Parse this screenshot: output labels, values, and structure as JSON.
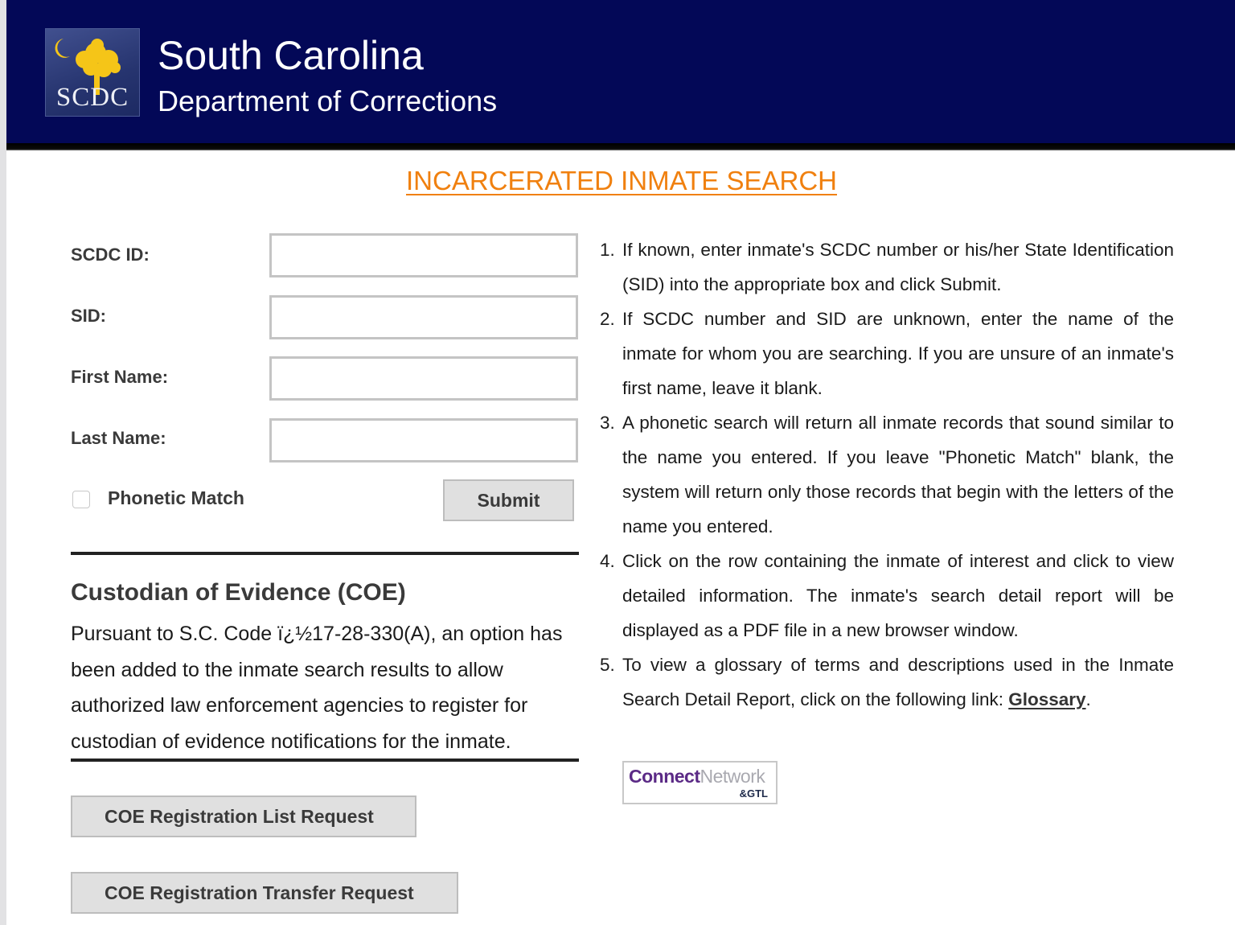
{
  "header": {
    "logo_text": "SCDC",
    "title": "South Carolina",
    "subtitle": "Department of Corrections"
  },
  "page": {
    "title": "INCARCERATED INMATE SEARCH",
    "accent_color": "#f0800f",
    "header_color": "#030857"
  },
  "form": {
    "fields": [
      {
        "label": "SCDC ID:",
        "value": "",
        "placeholder": ""
      },
      {
        "label": "SID:",
        "value": "",
        "placeholder": ""
      },
      {
        "label": "First Name:",
        "value": "",
        "placeholder": ""
      },
      {
        "label": "Last Name:",
        "value": "",
        "placeholder": ""
      }
    ],
    "phonetic_label": "Phonetic Match",
    "phonetic_checked": false,
    "submit_label": "Submit"
  },
  "coe": {
    "title": "Custodian of Evidence (COE)",
    "text": "Pursuant to S.C. Code ï¿½17-28-330(A), an option has been added to the inmate search results to allow authorized law enforcement agencies to register for custodian of evidence notifications for the inmate.",
    "list_request_label": "COE Registration List Request",
    "transfer_request_label": "COE Registration Transfer Request"
  },
  "instructions": {
    "items": [
      {
        "num": "1.",
        "text": "If known, enter inmate's SCDC number or his/her State Identification (SID) into the appropriate box and click Submit."
      },
      {
        "num": "2.",
        "text": "If SCDC number and SID are unknown, enter the name of the inmate for whom you are searching. If you are unsure of an inmate's first name, leave it blank."
      },
      {
        "num": "3.",
        "text": "A phonetic search will return all inmate records that sound similar to the name you entered. If you leave \"Phonetic Match\" blank, the system will return only those records that begin with the letters of the name you entered."
      },
      {
        "num": "4.",
        "text": "Click on the row containing the inmate of interest and click to view detailed information. The inmate's search detail report will be displayed as a PDF file in a new browser window."
      },
      {
        "num": "5.",
        "text": "To view a glossary of terms and descriptions used in the Inmate Search Detail Report, click on the following link: "
      }
    ],
    "glossary_link": "Glossary",
    "glossary_suffix": "."
  },
  "partner_logo": {
    "part1": "Connect",
    "part2": "Network",
    "part3": "&GTL"
  }
}
